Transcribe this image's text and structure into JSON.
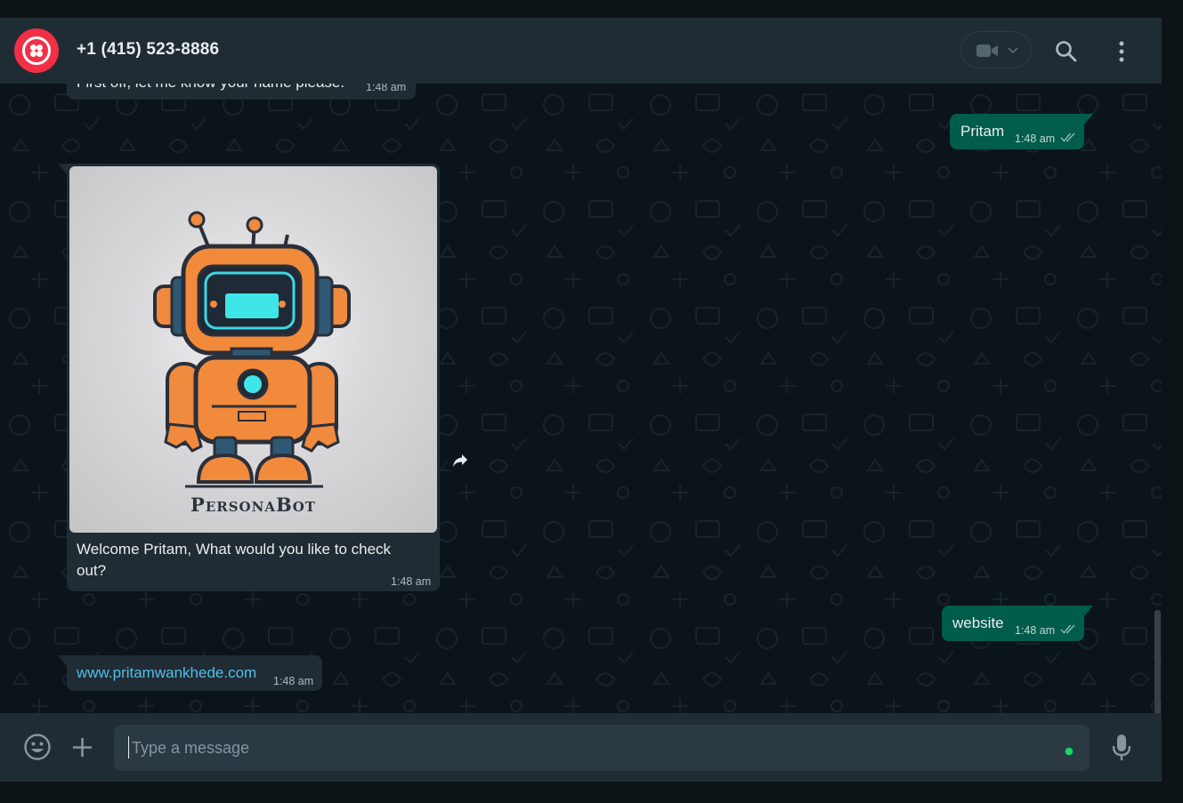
{
  "header": {
    "contact_name": "+1 (415) 523-8886",
    "avatar_icon": "twilio-logo-icon",
    "video_icon": "video-camera-icon",
    "video_dropdown_icon": "chevron-down-icon",
    "search_icon": "search-icon",
    "menu_icon": "more-vertical-icon"
  },
  "messages": [
    {
      "direction": "incoming",
      "text": "First off, let me know your name please.",
      "time": "1:48 am"
    },
    {
      "direction": "outgoing",
      "text": "Pritam",
      "time": "1:48 am",
      "status": "read"
    },
    {
      "direction": "incoming",
      "image_caption": "PersonaBot",
      "text": "Welcome Pritam, What would you like to check out?",
      "time": "1:48 am"
    },
    {
      "direction": "outgoing",
      "text": "website",
      "time": "1:48 am",
      "status": "read"
    },
    {
      "direction": "incoming",
      "text": "www.pritamwankhede.com",
      "time": "1:48 am",
      "is_link": true
    }
  ],
  "composer": {
    "placeholder": "Type a message",
    "emoji_icon": "emoji-icon",
    "attach_icon": "plus-icon",
    "mic_icon": "microphone-icon"
  },
  "colors": {
    "header_bg": "#202c33",
    "chat_bg": "#0b141a",
    "incoming_bubble": "#202c33",
    "outgoing_bubble": "#005c4b",
    "link": "#53bdeb",
    "read_ticks": "#8fb6ad"
  }
}
